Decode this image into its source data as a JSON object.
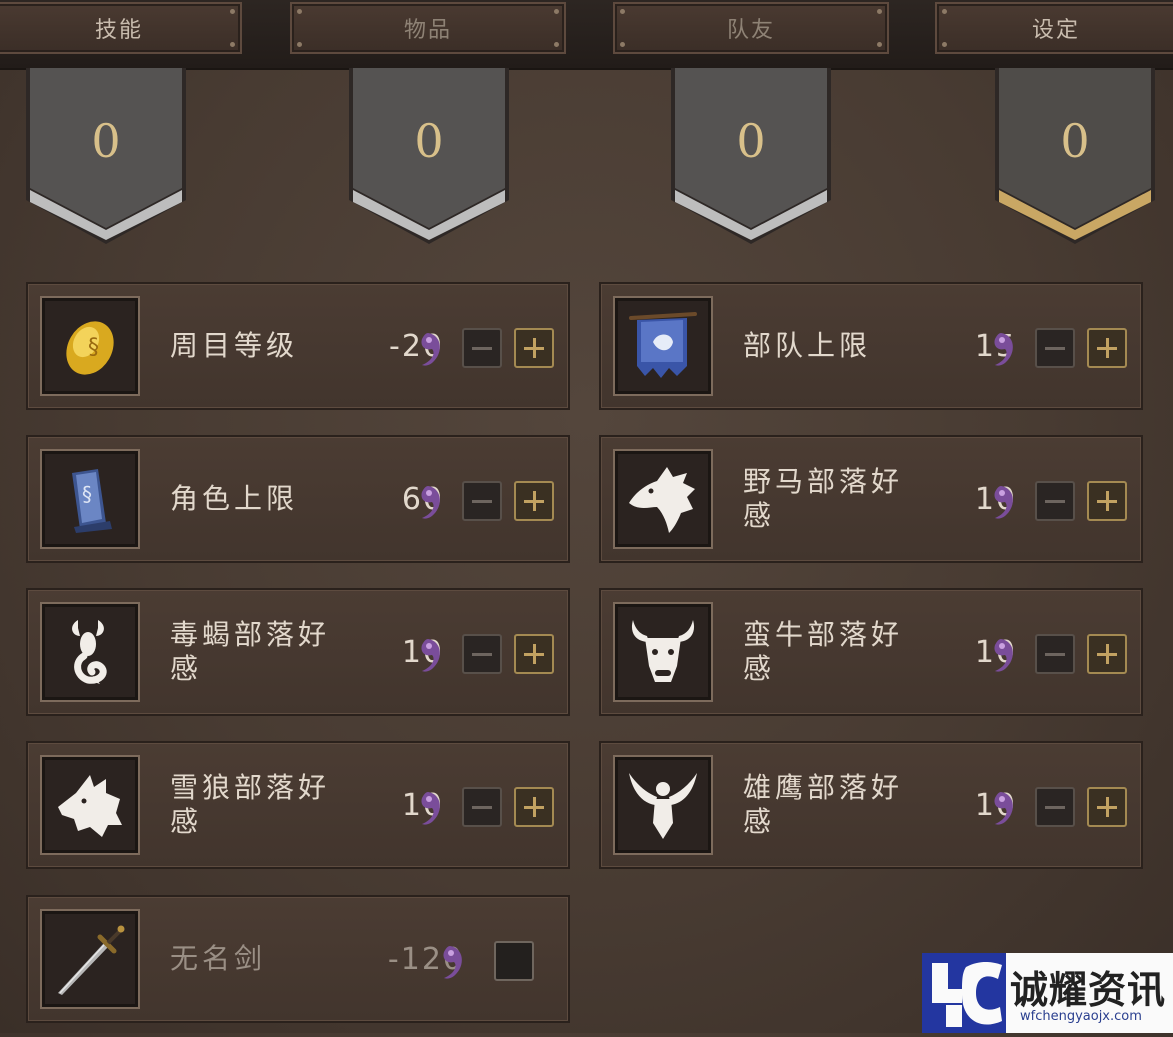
{
  "tabs": [
    {
      "label": "技能",
      "active": false
    },
    {
      "label": "物品",
      "active": false
    },
    {
      "label": "队友",
      "active": false
    },
    {
      "label": "设定",
      "active": true
    }
  ],
  "banners": [
    "0",
    "0",
    "0",
    "0"
  ],
  "colors": {
    "accent_gold": "#c9a764",
    "swirl_purple": "#7a4d9a",
    "text": "#e2d8cc"
  },
  "left_items": [
    {
      "name": "周目等级",
      "value": "-20",
      "icon": "golden-egg-icon",
      "control": "stepper"
    },
    {
      "name": "角色上限",
      "value": "60",
      "icon": "tombstone-icon",
      "control": "stepper"
    },
    {
      "name": "毒蝎部落好感",
      "value": "10",
      "icon": "scorpion-icon",
      "control": "stepper"
    },
    {
      "name": "雪狼部落好感",
      "value": "10",
      "icon": "wolf-icon",
      "control": "stepper"
    },
    {
      "name": "无名剑",
      "value": "-120",
      "icon": "sword-icon",
      "control": "checkbox",
      "checked": false
    }
  ],
  "right_items": [
    {
      "name": "部队上限",
      "value": "15",
      "icon": "war-banner-icon",
      "control": "stepper"
    },
    {
      "name": "野马部落好感",
      "value": "10",
      "icon": "horse-icon",
      "control": "stepper"
    },
    {
      "name": "蛮牛部落好感",
      "value": "10",
      "icon": "bull-icon",
      "control": "stepper"
    },
    {
      "name": "雄鹰部落好感",
      "value": "10",
      "icon": "eagle-icon",
      "control": "stepper"
    }
  ],
  "watermark": {
    "brand": "诚耀资讯",
    "url": "wfchengyaojx.com"
  }
}
